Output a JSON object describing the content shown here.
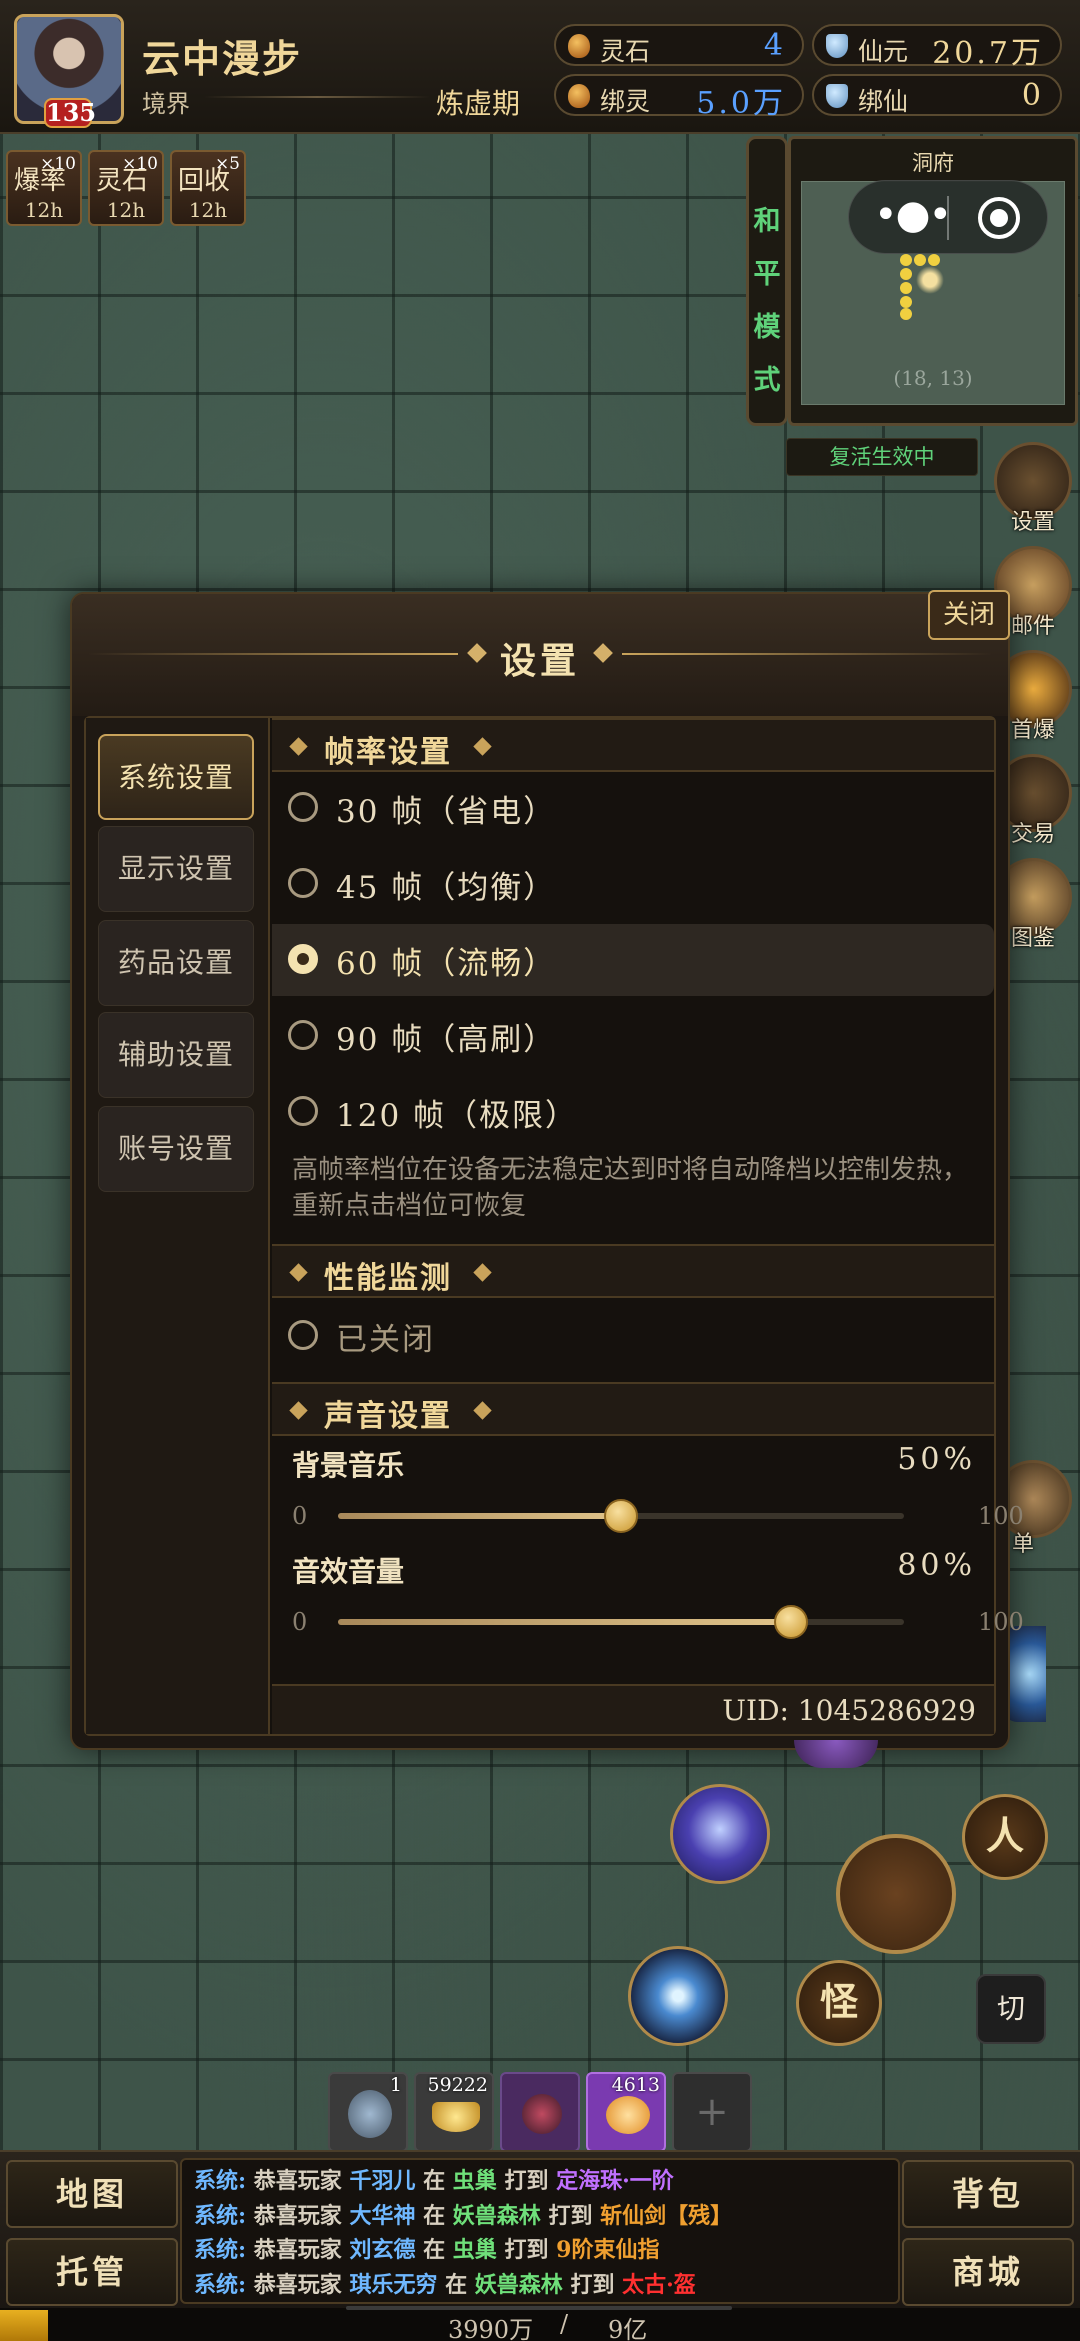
{
  "player": {
    "name": "云中漫步",
    "level": "135",
    "realm_label": "境界",
    "realm_value": "炼虚期"
  },
  "resources": [
    {
      "label": "灵石",
      "value": "4",
      "color": "#5aa0ff",
      "icon": "spirit-stone-icon"
    },
    {
      "label": "仙元",
      "value": "20.7万",
      "color": "#f0d79a",
      "icon": "ingot-icon"
    },
    {
      "label": "绑灵",
      "value": "5.0万",
      "color": "#5aa0ff",
      "icon": "bound-spirit-icon"
    },
    {
      "label": "绑仙",
      "value": "0",
      "color": "#f0d79a",
      "icon": "bound-ingot-icon"
    }
  ],
  "buffs": [
    {
      "name": "爆率",
      "count": "×10",
      "time": "12h"
    },
    {
      "name": "灵石",
      "count": "×10",
      "time": "12h"
    },
    {
      "name": "回收",
      "count": "×5",
      "time": "12h"
    }
  ],
  "mode": [
    "和",
    "平",
    "模",
    "式"
  ],
  "minimap": {
    "title": "洞府",
    "coords": "(18, 13)"
  },
  "revive_status": "复活生效中",
  "side_buttons": [
    "设置",
    "邮件",
    "首爆",
    "交易",
    "图鉴",
    "单"
  ],
  "dialog": {
    "title": "设置",
    "close": "关闭",
    "tabs": [
      "系统设置",
      "显示设置",
      "药品设置",
      "辅助设置",
      "账号设置"
    ],
    "active_tab": 0,
    "framerate": {
      "title": "帧率设置",
      "options": [
        "30 帧（省电）",
        "45 帧（均衡）",
        "60 帧（流畅）",
        "90 帧（高刷）",
        "120 帧（极限）"
      ],
      "selected": 2,
      "note": "高帧率档位在设备无法稳定达到时将自动降档以控制发热，重新点击档位可恢复"
    },
    "perf": {
      "title": "性能监测",
      "option": "已关闭"
    },
    "sound": {
      "title": "声音设置",
      "bgm_label": "背景音乐",
      "bgm_value": "50%",
      "bgm_level": 50,
      "sfx_label": "音效音量",
      "sfx_value": "80%",
      "sfx_level": 80,
      "min": "0",
      "max": "100"
    },
    "uid": "UID:  1045286929"
  },
  "action_buttons": {
    "person": "人",
    "monster": "怪",
    "switch": "切"
  },
  "items": [
    {
      "count": "1"
    },
    {
      "count": "59222"
    },
    {
      "count": ""
    },
    {
      "count": "4613"
    },
    {
      "count": "+"
    }
  ],
  "bottom": {
    "map": "地图",
    "auto": "托管",
    "bag": "背包",
    "shop": "商城"
  },
  "chat": [
    [
      {
        "t": "系统:",
        "c": "#6fb8ff"
      },
      {
        "t": " 恭喜玩家 ",
        "c": "#d8d0c0"
      },
      {
        "t": "千羽儿",
        "c": "#6fb8ff"
      },
      {
        "t": " 在 ",
        "c": "#d8d0c0"
      },
      {
        "t": "虫巢",
        "c": "#6fe07a"
      },
      {
        "t": " 打到 ",
        "c": "#d8d0c0"
      },
      {
        "t": "定海珠·一阶",
        "c": "#c070ff"
      }
    ],
    [
      {
        "t": "系统:",
        "c": "#6fb8ff"
      },
      {
        "t": " 恭喜玩家 ",
        "c": "#d8d0c0"
      },
      {
        "t": "大华神",
        "c": "#6fb8ff"
      },
      {
        "t": " 在 ",
        "c": "#d8d0c0"
      },
      {
        "t": "妖兽森林",
        "c": "#6fe07a"
      },
      {
        "t": " 打到 ",
        "c": "#d8d0c0"
      },
      {
        "t": "斩仙剑【残】",
        "c": "#f0a030"
      }
    ],
    [
      {
        "t": "系统:",
        "c": "#6fb8ff"
      },
      {
        "t": " 恭喜玩家 ",
        "c": "#d8d0c0"
      },
      {
        "t": "刘玄德",
        "c": "#6fb8ff"
      },
      {
        "t": " 在 ",
        "c": "#d8d0c0"
      },
      {
        "t": "虫巢",
        "c": "#6fe07a"
      },
      {
        "t": " 打到 ",
        "c": "#d8d0c0"
      },
      {
        "t": "9阶束仙指",
        "c": "#f0a030"
      }
    ],
    [
      {
        "t": "系统:",
        "c": "#6fb8ff"
      },
      {
        "t": " 恭喜玩家 ",
        "c": "#d8d0c0"
      },
      {
        "t": "琪乐无穷",
        "c": "#6fb8ff"
      },
      {
        "t": " 在 ",
        "c": "#d8d0c0"
      },
      {
        "t": "妖兽森林",
        "c": "#6fe07a"
      },
      {
        "t": " 打到 ",
        "c": "#d8d0c0"
      },
      {
        "t": "太古·盔",
        "c": "#ff3030"
      }
    ]
  ],
  "xp": {
    "current": "3990万",
    "max": "9亿"
  }
}
